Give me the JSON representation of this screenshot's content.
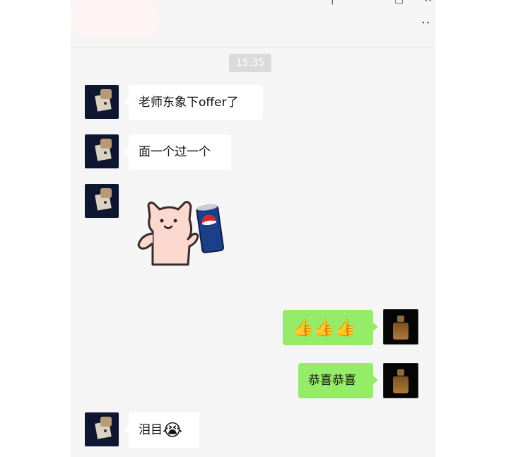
{
  "header": {
    "more_label": "··"
  },
  "timestamp": "15:35",
  "messages": [
    {
      "side": "in",
      "text": "老师东象下offer了"
    },
    {
      "side": "in",
      "text": "面一个过一个"
    },
    {
      "side": "in",
      "type": "sticker",
      "sticker": "cat-with-pepsi-can"
    },
    {
      "side": "out",
      "text": "👍👍👍"
    },
    {
      "side": "out",
      "text": "恭喜恭喜"
    },
    {
      "side": "in",
      "text": "泪目",
      "emoji": "😭"
    }
  ],
  "colors": {
    "window_bg": "#f5f5f5",
    "bubble_in": "#ffffff",
    "bubble_out": "#95ec69",
    "timestamp_bg": "#dadada"
  }
}
